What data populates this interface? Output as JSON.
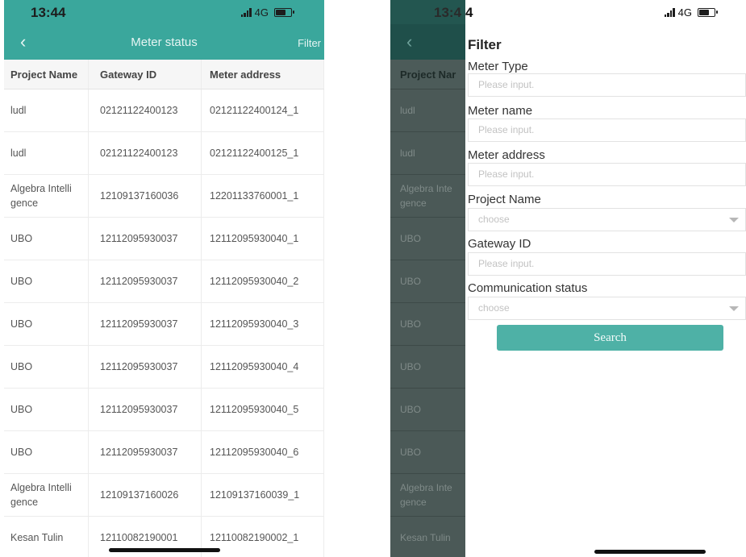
{
  "status": {
    "time": "13:44",
    "network": "4G"
  },
  "nav": {
    "back_icon": "chevron-left-icon",
    "title": "Meter status",
    "filter_label": "Filter"
  },
  "table": {
    "headers": [
      "Project Name",
      "Gateway ID",
      "Meter address"
    ],
    "rows": [
      [
        "ludl",
        "02121122400123",
        "02121122400124_1"
      ],
      [
        "ludl",
        "02121122400123",
        "02121122400125_1"
      ],
      [
        "Algebra Intelli\ngence",
        "12109137160036",
        "12201133760001_1"
      ],
      [
        "UBO",
        "12112095930037",
        "12112095930040_1"
      ],
      [
        "UBO",
        "12112095930037",
        "12112095930040_2"
      ],
      [
        "UBO",
        "12112095930037",
        "12112095930040_3"
      ],
      [
        "UBO",
        "12112095930037",
        "12112095930040_4"
      ],
      [
        "UBO",
        "12112095930037",
        "12112095930040_5"
      ],
      [
        "UBO",
        "12112095930037",
        "12112095930040_6"
      ],
      [
        "Algebra Intelli\ngence",
        "12109137160026",
        "12109137160039_1"
      ],
      [
        "Kesan Tulin",
        "12110082190001",
        "12110082190002_1"
      ]
    ]
  },
  "overlay": {
    "time_partial": "13:4",
    "time_last_digit": "4",
    "header_partial": "Project Nar",
    "rows": [
      "ludl",
      "ludl",
      "Algebra Inte\ngence",
      "UBO",
      "UBO",
      "UBO",
      "UBO",
      "UBO",
      "UBO",
      "Algebra Inte\ngence",
      "Kesan Tulin"
    ]
  },
  "filter": {
    "title": "Filter",
    "fields": [
      {
        "label": "Meter Type",
        "placeholder": "Please input.",
        "kind": "input"
      },
      {
        "label": "Meter name",
        "placeholder": "Please input.",
        "kind": "input"
      },
      {
        "label": "Meter address",
        "placeholder": "Please input.",
        "kind": "input"
      },
      {
        "label": "Project Name",
        "placeholder": "choose",
        "kind": "select"
      },
      {
        "label": "Gateway ID",
        "placeholder": "Please input.",
        "kind": "input"
      },
      {
        "label": "Communication status",
        "placeholder": "choose",
        "kind": "select"
      }
    ],
    "search_label": "Search"
  },
  "colors": {
    "accent": "#3aa79c",
    "button": "#4eb1a6"
  }
}
